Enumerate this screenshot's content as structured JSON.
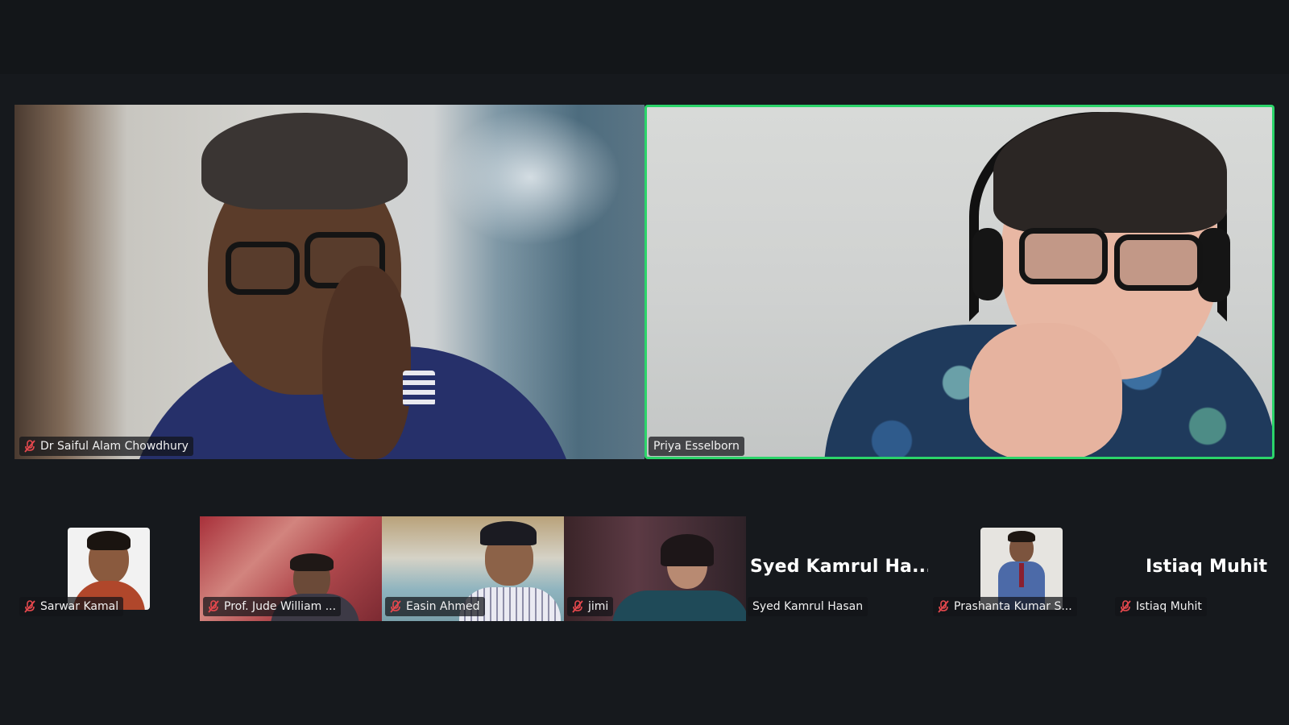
{
  "speakers": [
    {
      "name": "Dr Saiful Alam Chowdhury",
      "muted": true,
      "active": false
    },
    {
      "name": "Priya Esselborn",
      "muted": false,
      "active": true
    }
  ],
  "gallery": [
    {
      "name": "Sarwar Kamal",
      "muted": true,
      "video": false
    },
    {
      "name": "Prof. Jude William ...",
      "muted": true,
      "video": true
    },
    {
      "name": "Easin Ahmed",
      "muted": true,
      "video": true
    },
    {
      "name": "jimi",
      "muted": true,
      "video": true
    },
    {
      "name": "Syed Kamrul Hasan",
      "display": "Syed  Kamrul  Ha...",
      "muted": false,
      "video": false
    },
    {
      "name": "Prashanta Kumar S...",
      "muted": true,
      "video": false
    },
    {
      "name": "Istiaq Muhit",
      "display": "Istiaq Muhit",
      "muted": true,
      "video": false
    }
  ],
  "colors": {
    "background": "#16191d",
    "active_speaker_border": "#2bd46a",
    "mute_icon": "#e5484d"
  }
}
